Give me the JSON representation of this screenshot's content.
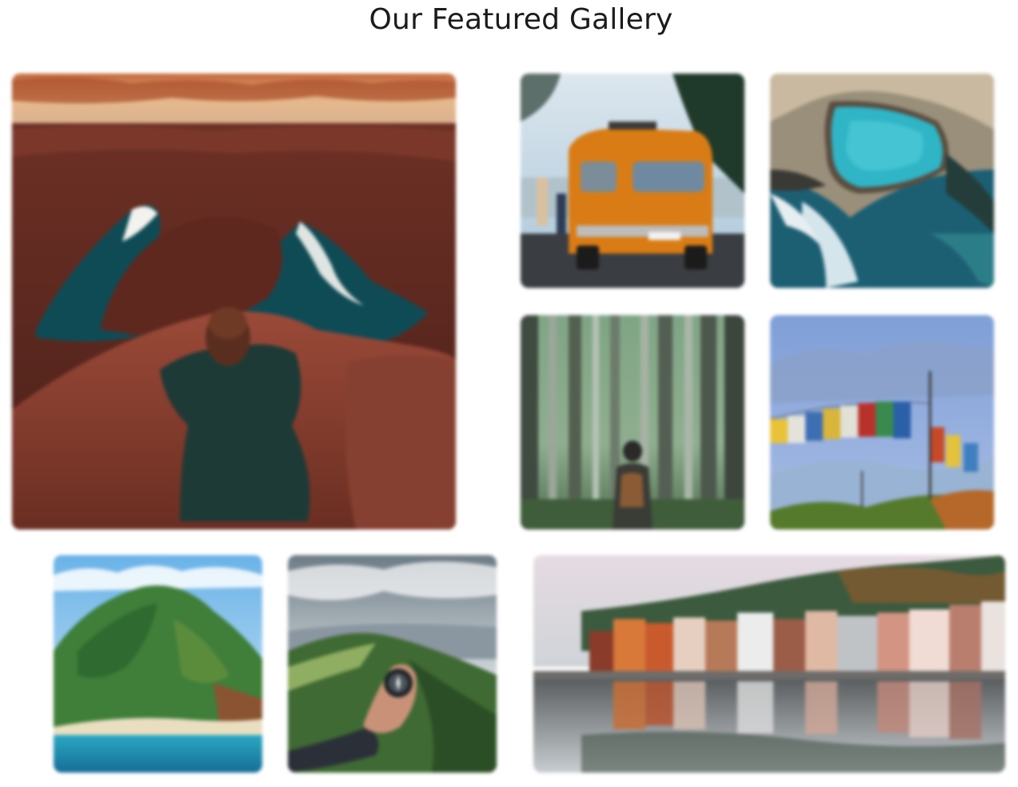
{
  "gallery": {
    "title": "Our Featured Gallery",
    "photos": [
      {
        "name": "canyon-photo",
        "subject": "canyon"
      },
      {
        "name": "van-photo",
        "subject": "van"
      },
      {
        "name": "pool-photo",
        "subject": "pool"
      },
      {
        "name": "forest-photo",
        "subject": "forest"
      },
      {
        "name": "prayer-flags-photo",
        "subject": "prayer-flags"
      },
      {
        "name": "island-photo",
        "subject": "island"
      },
      {
        "name": "compass-photo",
        "subject": "compass"
      },
      {
        "name": "harbor-photo",
        "subject": "harbor"
      }
    ]
  },
  "colors": {
    "background": "#ffffff",
    "title": "#1b1b1b"
  }
}
